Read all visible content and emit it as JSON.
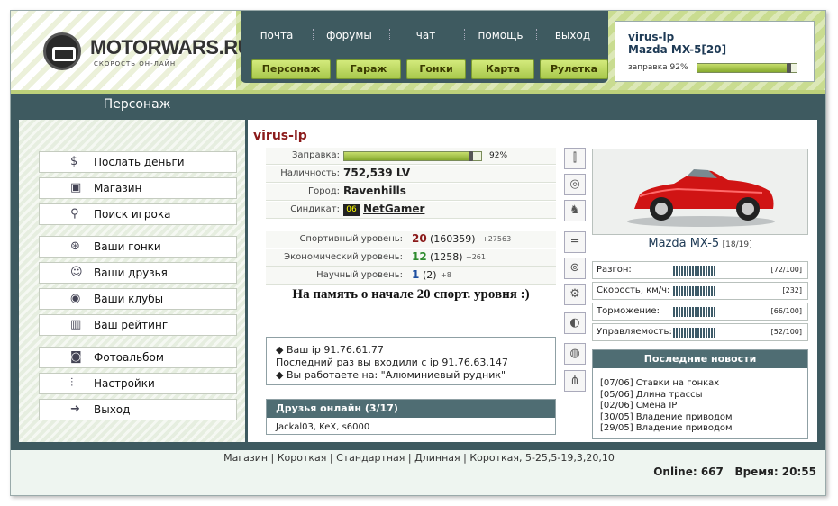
{
  "logo": {
    "title": "MOTORWARS.RU",
    "subtitle": "СКОРОСТЬ ОН-ЛАЙН"
  },
  "topnav": [
    "почта",
    "форумы",
    "чат",
    "помощь",
    "выход"
  ],
  "greennav": [
    "Персонаж",
    "Гараж",
    "Гонки",
    "Карта",
    "Рулетка"
  ],
  "userbox": {
    "name": "virus-lp",
    "car": "Mazda MX-5[20]",
    "fuel_label": "заправка 92%",
    "fuel": 0.92
  },
  "sidebar": {
    "title": "Персонаж",
    "items": [
      "Послать деньги",
      "Магазин",
      "Поиск игрока",
      "Ваши гонки",
      "Ваши друзья",
      "Ваши клубы",
      "Ваш рейтинг",
      "Фотоальбом",
      "Настройки",
      "Выход"
    ],
    "icons": [
      "money-icon",
      "shop-icon",
      "search-icon",
      "wheel-icon",
      "friends-icon",
      "clubs-icon",
      "rating-icon",
      "photo-icon",
      "settings-icon",
      "exit-icon"
    ]
  },
  "profile": {
    "name": "virus-lp",
    "fuel_label": "Заправка:",
    "fuel_pct": "92%",
    "fuel": 0.92,
    "cash_label": "Наличность:",
    "cash": "752,539 LV",
    "city_label": "Город:",
    "city": "Ravenhills",
    "syndicate_label": "Синдикат:",
    "syndicate_badge": "06",
    "syndicate": "NetGamer",
    "sport_label": "Спортивный уровень:",
    "sport_level": "20",
    "sport_points": "(160359)",
    "sport_delta": "+27563",
    "econ_label": "Экономический уровень:",
    "econ_level": "12",
    "econ_points": "(1258)",
    "econ_delta": "+261",
    "sci_label": "Научный уровень:",
    "sci_level": "1",
    "sci_points": "(2)",
    "sci_delta": "+8",
    "status_message": "На память о начале 20 спорт. уровня :)"
  },
  "ipinfo": {
    "ip": "Ваш ip 91.76.61.77",
    "last": "Последний раз вы входили с ip 91.76.63.147",
    "work": "Вы работаете на: \"Алюминиевый рудник\""
  },
  "friends": {
    "title": "Друзья онлайн (3/17)",
    "list": "Jackal03, KeX, s6000"
  },
  "car": {
    "name": "Mazda MX-5",
    "level": "[18/19]",
    "stats": [
      {
        "label": "Разгон:",
        "value": "[72/100]"
      },
      {
        "label": "Скорость, км/ч:",
        "value": "[232]"
      },
      {
        "label": "Торможение:",
        "value": "[66/100]"
      },
      {
        "label": "Управляемость:",
        "value": "[52/100]"
      }
    ]
  },
  "news": {
    "title": "Последние новости",
    "items": [
      "[07/06] Ставки на гонках",
      "[05/06] Длина трассы",
      "[02/06] Смена IP",
      "[30/05] Владение приводом",
      "[29/05] Владение приводом"
    ]
  },
  "footer": {
    "links": "Магазин | Короткая | Стандартная | Длинная | Короткая, 5-25,5-19,3,20,10",
    "online": "Online: 667",
    "time": "Время: 20:55"
  },
  "colors": {
    "header_green": "#c9dc90",
    "panel_dark": "#3e5a60",
    "name_red": "#8b1a1a",
    "level_green": "#2e8b2e",
    "level_blue": "#1e4fa0"
  }
}
